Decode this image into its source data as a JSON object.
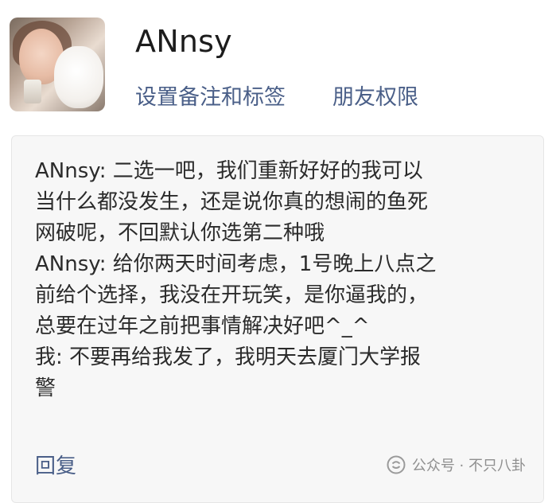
{
  "contact": {
    "name": "ANnsy",
    "set_remark_label": "设置备注和标签",
    "friend_permission_label": "朋友权限"
  },
  "message": {
    "lines": [
      "ANnsy: 二选一吧，我们重新好好的我可以",
      "当什么都没发生，还是说你真的想闹的鱼死",
      "网破呢，不回默认你选第二种哦",
      "ANnsy: 给你两天时间考虑，1号晚上八点之",
      "前给个选择，我没在开玩笑，是你逼我的，",
      "总要在过年之前把事情解决好吧^_^",
      "我: 不要再给我发了，我明天去厦门大学报",
      "警"
    ],
    "reply_label": "回复"
  },
  "watermark": {
    "text": "公众号 · 不只八卦",
    "icon": "wechat-official-account-icon"
  },
  "colors": {
    "link": "#4a5f88",
    "text": "#2b2b2b",
    "card_bg": "#f7f7f7"
  }
}
